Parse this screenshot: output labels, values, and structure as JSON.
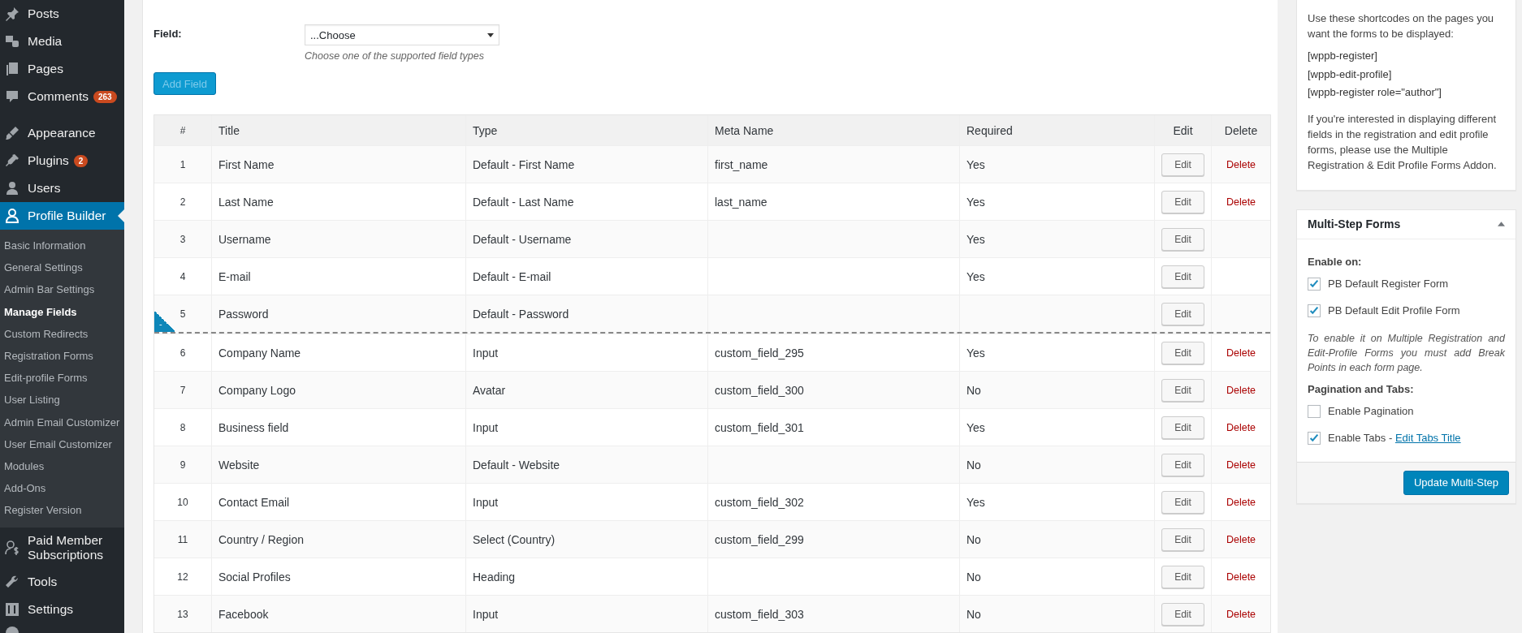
{
  "sidebar": {
    "items": [
      {
        "label": "Posts",
        "selected": false
      },
      {
        "label": "Media",
        "selected": false
      },
      {
        "label": "Pages",
        "selected": false
      },
      {
        "label": "Comments",
        "badge": "263",
        "selected": false
      },
      {
        "label": "Appearance",
        "selected": false
      },
      {
        "label": "Plugins",
        "badge": "2",
        "selected": false
      },
      {
        "label": "Users",
        "selected": false
      },
      {
        "label": "Profile Builder",
        "selected": true,
        "children": [
          {
            "label": "Basic Information",
            "selected": false
          },
          {
            "label": "General Settings",
            "selected": false
          },
          {
            "label": "Admin Bar Settings",
            "selected": false
          },
          {
            "label": "Manage Fields",
            "selected": true
          },
          {
            "label": "Custom Redirects",
            "selected": false
          },
          {
            "label": "Registration Forms",
            "selected": false
          },
          {
            "label": "Edit-profile Forms",
            "selected": false
          },
          {
            "label": "User Listing",
            "selected": false
          },
          {
            "label": "Admin Email Customizer",
            "selected": false
          },
          {
            "label": "User Email Customizer",
            "selected": false
          },
          {
            "label": "Modules",
            "selected": false
          },
          {
            "label": "Add-Ons",
            "selected": false
          },
          {
            "label": "Register Version",
            "selected": false
          }
        ]
      },
      {
        "label": "Paid Member Subscriptions",
        "selected": false
      },
      {
        "label": "Tools",
        "selected": false
      },
      {
        "label": "Settings",
        "selected": false
      }
    ]
  },
  "form": {
    "label": "Field:",
    "select": {
      "value": "...Choose"
    },
    "hint": "Choose one of the supported field types",
    "add_button": "Add Field"
  },
  "table": {
    "columns": [
      "#",
      "Title",
      "Type",
      "Meta Name",
      "Required",
      "Edit",
      "Delete"
    ],
    "rows": [
      {
        "num": "1",
        "title": "First Name",
        "type": "Default - First Name",
        "meta": "first_name",
        "required": "Yes",
        "edit": "Edit",
        "delete": "Delete"
      },
      {
        "num": "2",
        "title": "Last Name",
        "type": "Default - Last Name",
        "meta": "last_name",
        "required": "Yes",
        "edit": "Edit",
        "delete": "Delete"
      },
      {
        "num": "3",
        "title": "Username",
        "type": "Default - Username",
        "required": "Yes",
        "edit": "Edit"
      },
      {
        "num": "4",
        "title": "E-mail",
        "type": "Default - E-mail",
        "required": "Yes",
        "edit": "Edit"
      },
      {
        "num": "5",
        "title": "Password",
        "type": "Default - Password",
        "edit": "Edit",
        "break_point": "-"
      },
      {
        "num": "6",
        "title": "Company Name",
        "type": "Input",
        "meta": "custom_field_295",
        "required": "Yes",
        "edit": "Edit",
        "delete": "Delete"
      },
      {
        "num": "7",
        "title": "Company Logo",
        "type": "Avatar",
        "meta": "custom_field_300",
        "required": "No",
        "edit": "Edit",
        "delete": "Delete"
      },
      {
        "num": "8",
        "title": "Business field",
        "type": "Input",
        "meta": "custom_field_301",
        "required": "Yes",
        "edit": "Edit",
        "delete": "Delete"
      },
      {
        "num": "9",
        "title": "Website",
        "type": "Default - Website",
        "required": "No",
        "edit": "Edit",
        "delete": "Delete"
      },
      {
        "num": "10",
        "title": "Contact Email",
        "type": "Input",
        "meta": "custom_field_302",
        "required": "Yes",
        "edit": "Edit",
        "delete": "Delete"
      },
      {
        "num": "11",
        "title": "Country / Region",
        "type": "Select (Country)",
        "meta": "custom_field_299",
        "required": "No",
        "edit": "Edit",
        "delete": "Delete"
      },
      {
        "num": "12",
        "title": "Social Profiles",
        "type": "Heading",
        "required": "No",
        "edit": "Edit",
        "delete": "Delete"
      },
      {
        "num": "13",
        "title": "Facebook",
        "type": "Input",
        "meta": "custom_field_303",
        "required": "No",
        "edit": "Edit",
        "delete": "Delete"
      }
    ]
  },
  "shortcodes_box": {
    "intro": "Use these shortcodes on the pages you want the forms to be displayed:",
    "codes": [
      "[wppb-register]",
      "[wppb-edit-profile]",
      "[wppb-register role=\"author\"]"
    ],
    "note": "If you're interested in displaying different fields in the registration and edit profile forms, please use the Multiple Registration & Edit Profile Forms Addon."
  },
  "multistep_box": {
    "title": "Multi-Step Forms",
    "expanded": true,
    "sections": [
      {
        "heading": "Enable on:",
        "options": [
          {
            "label": "PB Default Register Form",
            "checked": true
          },
          {
            "label": "PB Default Edit Profile Form",
            "checked": true
          }
        ],
        "note": "To enable it on Multiple Registration and Edit-Profile Forms you must add Break Points in each form page."
      },
      {
        "heading": "Pagination and Tabs:",
        "options": [
          {
            "label": "Enable Pagination",
            "checked": false
          },
          {
            "label": "Enable Tabs - ",
            "link": "Edit Tabs Title",
            "checked": true
          }
        ]
      }
    ],
    "button": "Update Multi-Step"
  }
}
